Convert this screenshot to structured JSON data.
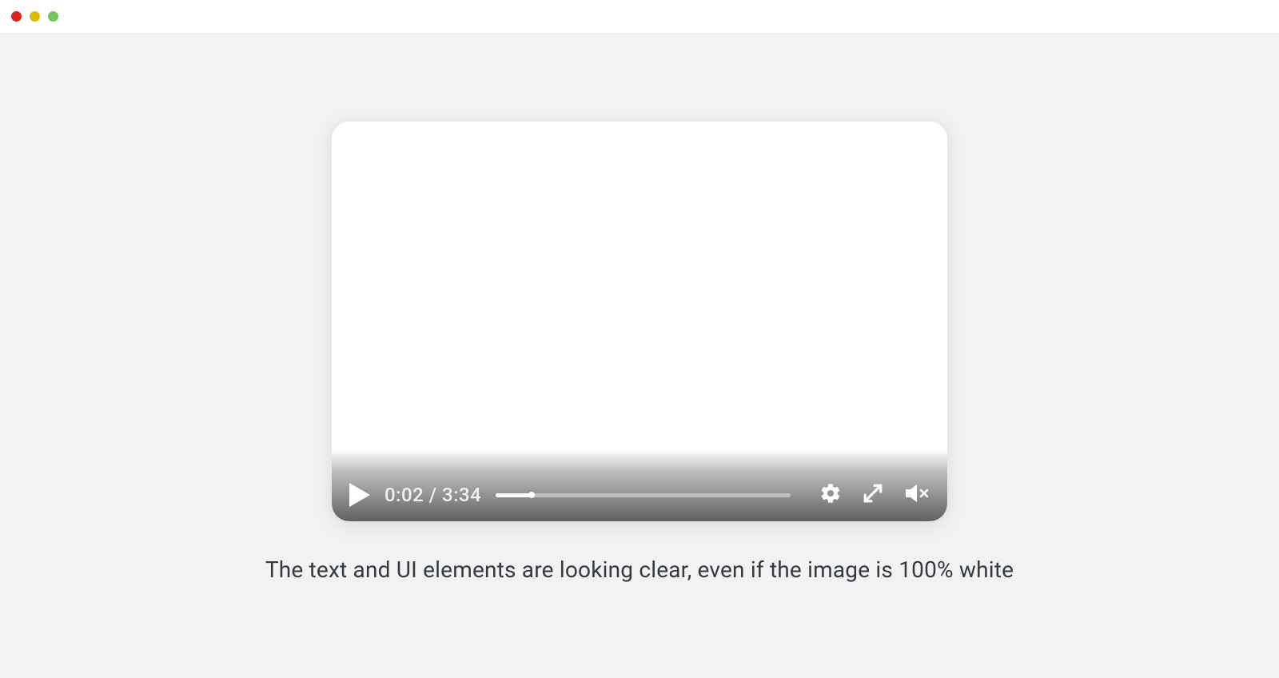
{
  "window": {
    "traffic_close": "close",
    "traffic_min": "minimize",
    "traffic_zoom": "zoom"
  },
  "video": {
    "current_time": "0:02",
    "separator": " / ",
    "duration": "3:34",
    "progress_percent": "12%",
    "icons": {
      "play": "play-icon",
      "settings": "gear-icon",
      "fullscreen": "fullscreen-icon",
      "mute": "speaker-muted-icon"
    }
  },
  "caption": "The text and UI elements are looking clear, even if the image is 100% white"
}
